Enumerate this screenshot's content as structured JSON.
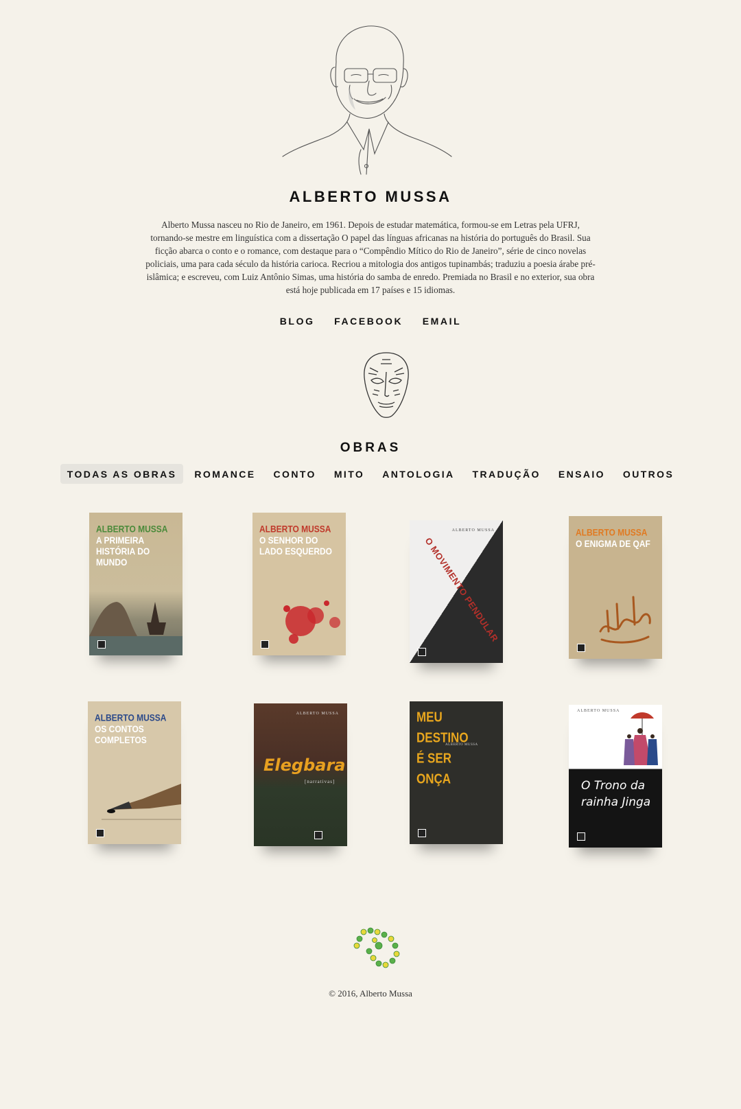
{
  "author": {
    "name": "ALBERTO MUSSA",
    "bio": "Alberto Mussa nasceu no Rio de Janeiro, em 1961. Depois de estudar matemática, formou-se em Letras pela UFRJ, tornando-se mestre em linguística com a dissertação O papel das línguas africanas na história do português do Brasil. Sua ficção abarca o conto e o romance, com destaque para o “Compêndio Mítico do Rio de Janeiro”, série de cinco novelas policiais, uma para cada século da história carioca. Recriou a mitologia dos antigos tupinambás; traduziu a poesia árabe pré-islâmica; e escreveu, com Luiz Antônio Simas, uma história do samba de enredo. Premiada no Brasil e no exterior, sua obra está hoje publicada em 17 países e 15 idiomas."
  },
  "links": {
    "blog": "BLOG",
    "facebook": "FACEBOOK",
    "email": "EMAIL"
  },
  "works": {
    "title": "OBRAS",
    "filters": [
      "TODAS AS OBRAS",
      "ROMANCE",
      "CONTO",
      "MITO",
      "ANTOLOGIA",
      "TRADUÇÃO",
      "ENSAIO",
      "OUTROS"
    ],
    "active_filter": "TODAS AS OBRAS",
    "books": [
      {
        "cover_author": "ALBERTO MUSSA",
        "cover_title": "A PRIMEIRA HISTÓRIA DO MUNDO"
      },
      {
        "cover_author": "ALBERTO MUSSA",
        "cover_title": "O SENHOR DO LADO ESQUERDO"
      },
      {
        "cover_author": "ALBERTO MUSSA",
        "cover_title": "O MOVIMENTO PENDULAR"
      },
      {
        "cover_author": "ALBERTO MUSSA",
        "cover_title": "O ENIGMA DE QAF"
      },
      {
        "cover_author": "ALBERTO MUSSA",
        "cover_title": "OS CONTOS COMPLETOS"
      },
      {
        "cover_author": "ALBERTO MUSSA",
        "cover_title": "Elegbara",
        "cover_subtitle": "[narrativas]"
      },
      {
        "cover_author": "ALBERTO MUSSA",
        "cover_title": "MEU DESTINO É SER ONÇA"
      },
      {
        "cover_author": "ALBERTO MUSSA",
        "cover_title": "O Trono da rainha Jinga"
      }
    ]
  },
  "footer": {
    "copyright": "© 2016, Alberto Mussa"
  },
  "colors": {
    "background": "#f5f2ea",
    "active_filter_bg": "#e6e4de"
  }
}
